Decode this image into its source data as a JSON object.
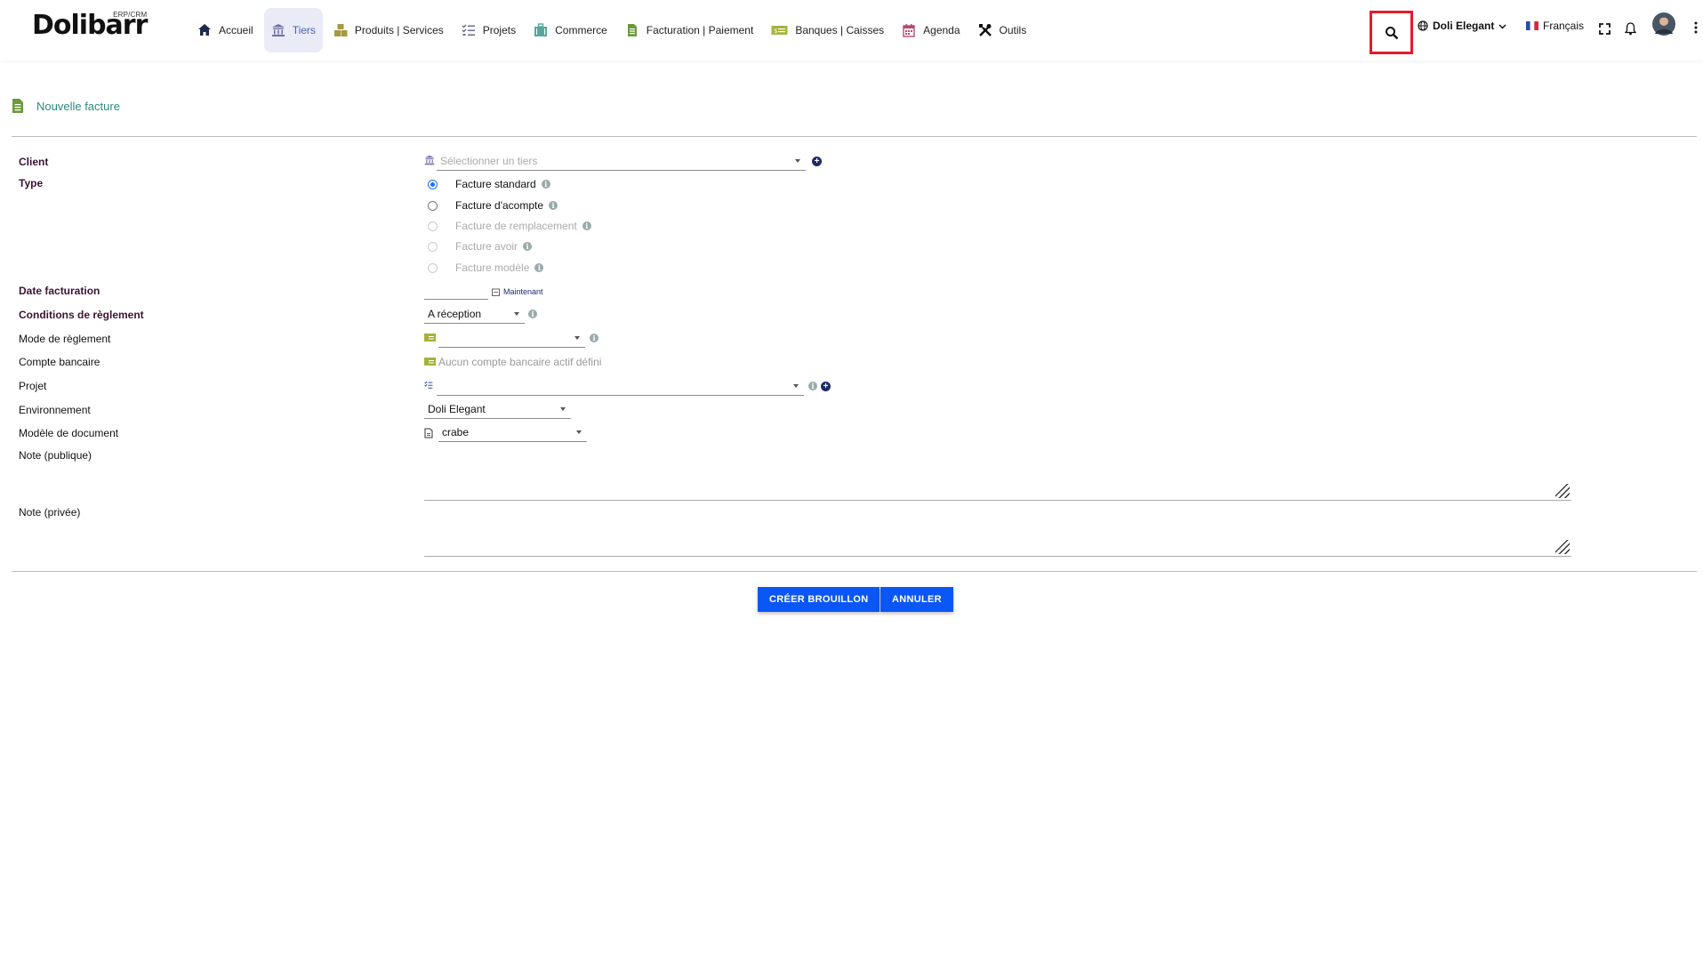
{
  "app": {
    "logo_text": "Dolibarr",
    "logo_sub": "ERP/CRM"
  },
  "menu": [
    {
      "label": "Accueil",
      "icon": "home-icon",
      "color": "#1d2a4b"
    },
    {
      "label": "Tiers",
      "icon": "building-icon",
      "color": "#6f6fa8",
      "active": true
    },
    {
      "label": "Produits | Services",
      "icon": "boxes-icon",
      "color": "#a69944"
    },
    {
      "label": "Projets",
      "icon": "tasks-icon",
      "color": "#6a6d8c"
    },
    {
      "label": "Commerce",
      "icon": "suitcase-icon",
      "color": "#59a6a0"
    },
    {
      "label": "Facturation | Paiement",
      "icon": "invoice-icon",
      "color": "#6c9a3a"
    },
    {
      "label": "Banques | Caisses",
      "icon": "money-icon",
      "color": "#a6b23a"
    },
    {
      "label": "Agenda",
      "icon": "calendar-icon",
      "color": "#b54b6e"
    },
    {
      "label": "Outils",
      "icon": "tools-icon",
      "color": "#111"
    }
  ],
  "toolbar": {
    "entity": "Doli Elegant",
    "language": "Français",
    "accent": "#e11d2a"
  },
  "page": {
    "title": "Nouvelle facture"
  },
  "form": {
    "client": {
      "label": "Client",
      "placeholder": "Sélectionner un tiers"
    },
    "type": {
      "label": "Type",
      "options": [
        {
          "label": "Facture standard",
          "checked": true,
          "disabled": false
        },
        {
          "label": "Facture d'acompte",
          "checked": false,
          "disabled": false
        },
        {
          "label": "Facture de remplacement",
          "checked": false,
          "disabled": true
        },
        {
          "label": "Facture avoir",
          "checked": false,
          "disabled": true
        },
        {
          "label": "Facture modèle",
          "checked": false,
          "disabled": true
        }
      ]
    },
    "date": {
      "label": "Date facturation",
      "now_label": "Maintenant"
    },
    "conditions": {
      "label": "Conditions de règlement",
      "value": "A réception"
    },
    "mode": {
      "label": "Mode de règlement",
      "value": ""
    },
    "compte": {
      "label": "Compte bancaire",
      "value": "Aucun compte bancaire actif défini"
    },
    "projet": {
      "label": "Projet",
      "value": ""
    },
    "environnement": {
      "label": "Environnement",
      "value": "Doli Elegant"
    },
    "modele": {
      "label": "Modèle de document",
      "value": "crabe"
    },
    "note_publique": {
      "label": "Note (publique)"
    },
    "note_privee": {
      "label": "Note (privée)"
    }
  },
  "buttons": {
    "create": "CRÉER BROUILLON",
    "cancel": "ANNULER"
  },
  "colors": {
    "primary_button": "#0b57f5",
    "required_label": "#3b1434",
    "title": "#2b8a7e"
  }
}
